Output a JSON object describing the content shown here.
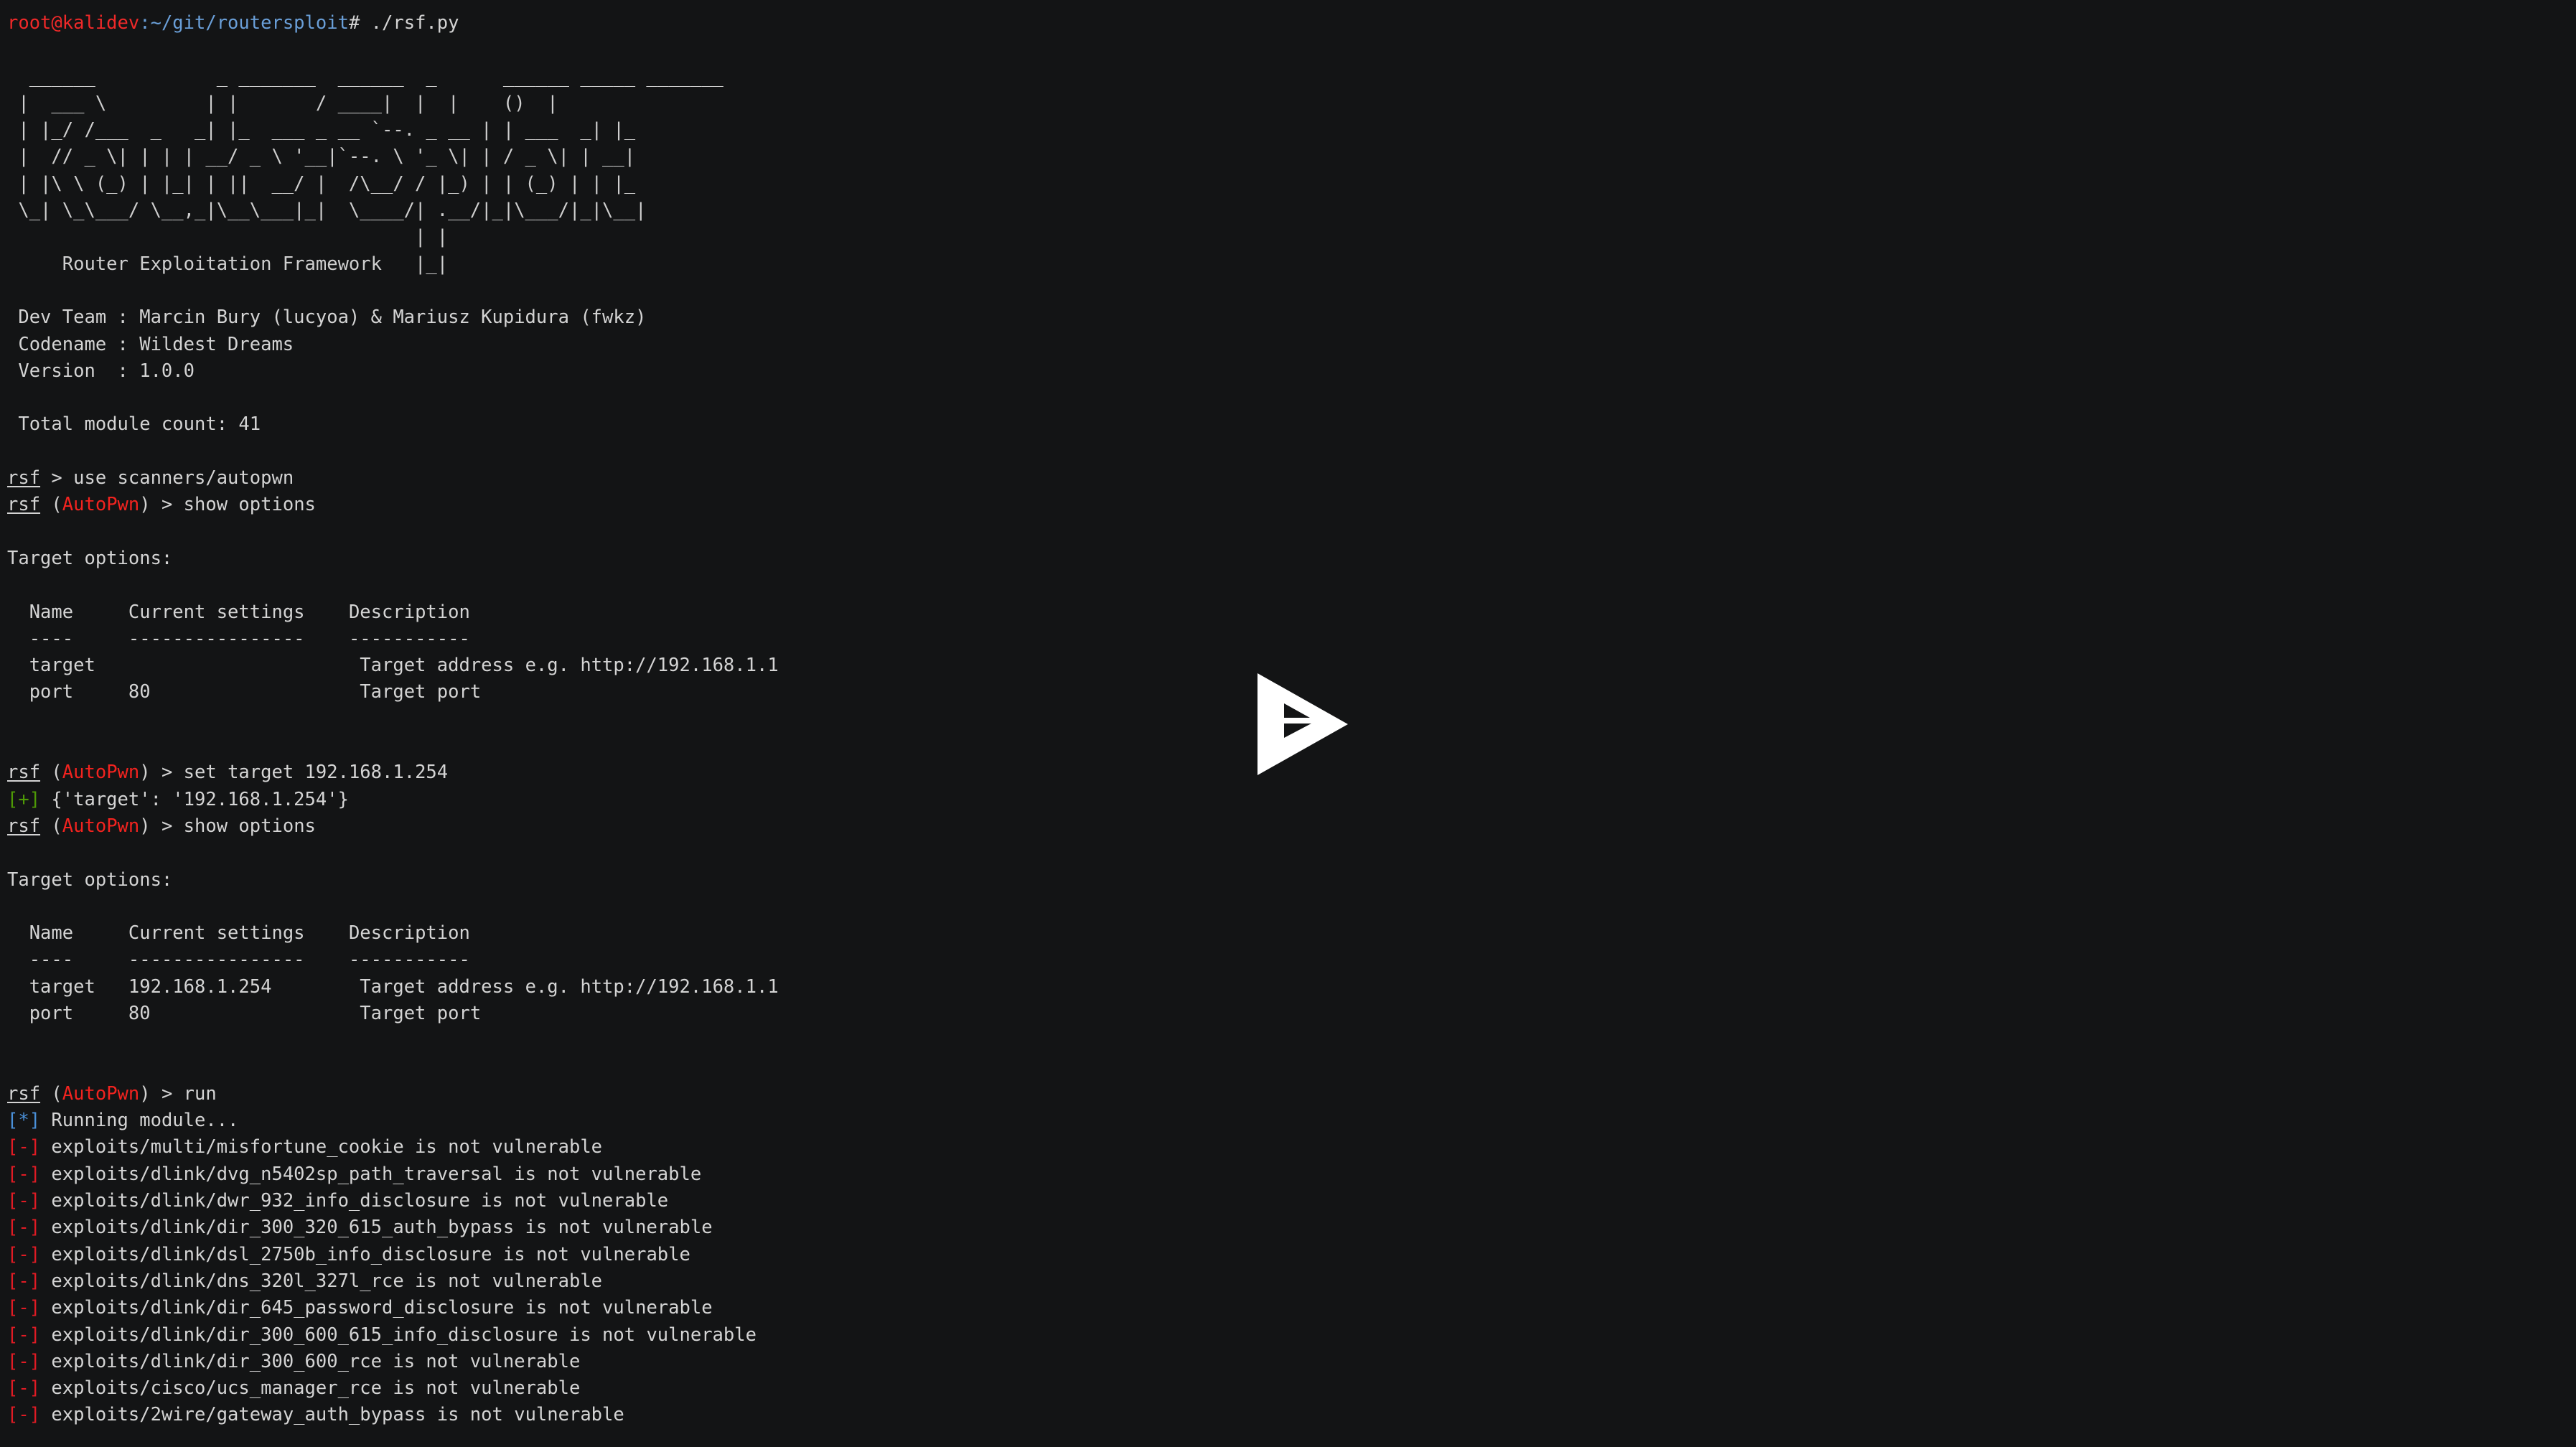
{
  "terminal": {
    "background_color": "#131415",
    "foreground_color": "#d4d4d4",
    "prompt": {
      "user_host": "root@kalidev",
      "user_host_color": "#ef2929",
      "path": ":~/git/routersploit",
      "path_color": "#6a9fd8",
      "sigil": "# ",
      "command": "./rsf.py"
    },
    "banner": {
      "art_lines": [
        "  ______           _ _______  ______  _      ______ _____ _______",
        " |  ___ \\         | |       / ____|  |  |    ()  |",
        " | |_/ /___  _   _| |_  ___ _ __ `--. _ __ | | ___  _| |_",
        " |  // _ \\| | | | __/ _ \\ '__|`--. \\ '_ \\| | / _ \\| | __|",
        " | |\\ \\ (_) | |_| | ||  __/ |  /\\__/ / |_) | | (_) | | |_",
        " \\_| \\_\\___/ \\__,_|\\__\\___|_|  \\____/| .__/|_|\\___/|_|\\__|",
        "                                     | |",
        "     Router Exploitation Framework   |_|"
      ],
      "title": "Router Exploitation Framework",
      "dev_team_label": " Dev Team ",
      "dev_team": " Dev Team : Marcin Bury (lucyoa) & Mariusz Kupidura (fwkz)",
      "codename": " Codename : Wildest Dreams",
      "version": " Version  : 1.0.0",
      "module_count": " Total module count: 41"
    },
    "session": {
      "rsf_label": "rsf",
      "module_name": "AutoPwn",
      "module_name_color": "#f2231f",
      "arrow": " > ",
      "commands": {
        "use": "use scanners/autopwn",
        "show_options": "show options",
        "set_target": "set target 192.168.1.254",
        "run": "run"
      },
      "set_result_tag": "[+]",
      "set_result": " {'target': '192.168.1.254'}",
      "running_tag": "[*]",
      "running_text": " Running module...",
      "fail_tag": "[-]"
    },
    "options_table": {
      "heading": "Target options:",
      "columns": [
        "Name",
        "Current settings",
        "Description"
      ],
      "separators": [
        "----",
        "----------------",
        "-----------"
      ],
      "before_set": [
        {
          "name": "target",
          "current": "",
          "description": "Target address e.g. http://192.168.1.1"
        },
        {
          "name": "port",
          "current": "80",
          "description": "Target port"
        }
      ],
      "after_set": [
        {
          "name": "target",
          "current": "192.168.1.254",
          "description": "Target address e.g. http://192.168.1.1"
        },
        {
          "name": "port",
          "current": "80",
          "description": "Target port"
        }
      ]
    },
    "scan_results": [
      "exploits/multi/misfortune_cookie is not vulnerable",
      "exploits/dlink/dvg_n5402sp_path_traversal is not vulnerable",
      "exploits/dlink/dwr_932_info_disclosure is not vulnerable",
      "exploits/dlink/dir_300_320_615_auth_bypass is not vulnerable",
      "exploits/dlink/dsl_2750b_info_disclosure is not vulnerable",
      "exploits/dlink/dns_320l_327l_rce is not vulnerable",
      "exploits/dlink/dir_645_password_disclosure is not vulnerable",
      "exploits/dlink/dir_300_600_615_info_disclosure is not vulnerable",
      "exploits/dlink/dir_300_600_rce is not vulnerable",
      "exploits/cisco/ucs_manager_rce is not vulnerable",
      "exploits/2wire/gateway_auth_bypass is not vulnerable"
    ]
  },
  "overlay": {
    "play_button_label": "play-video",
    "play_button_color": "#ffffff"
  }
}
